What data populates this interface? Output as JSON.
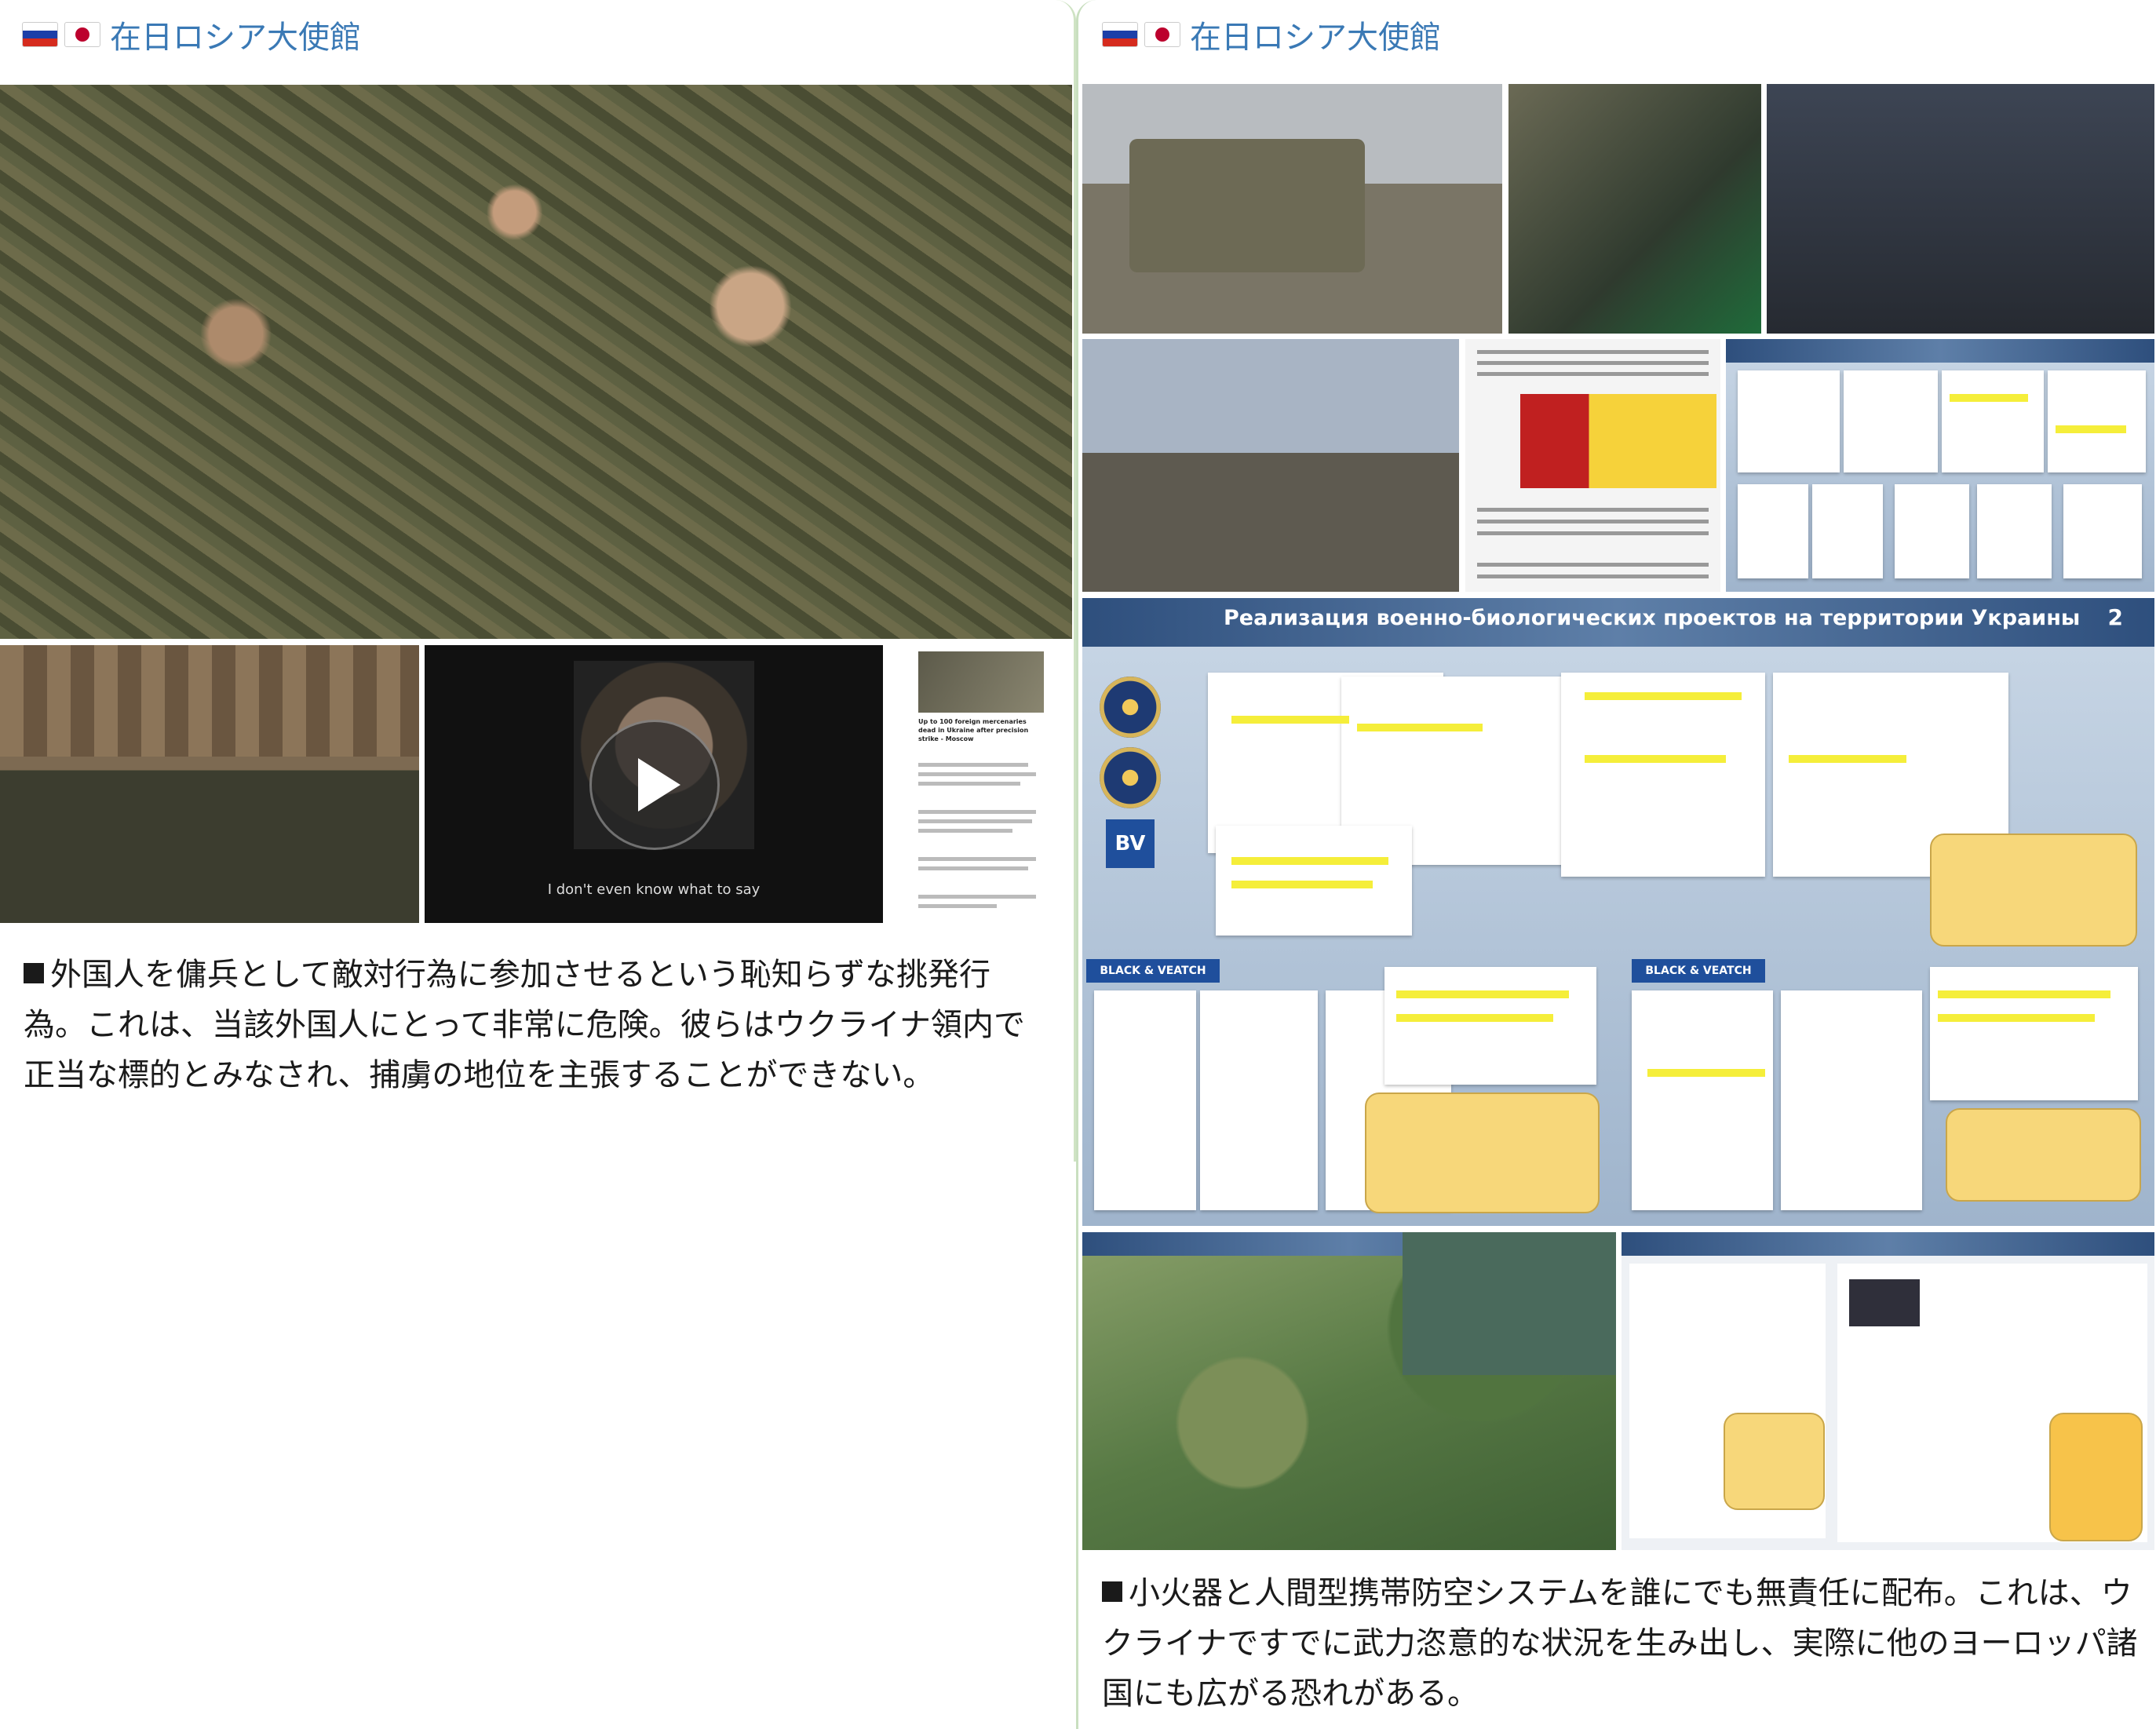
{
  "posts": [
    {
      "channel": {
        "name": "在日ロシア大使館",
        "flags": [
          "russia-flag-icon",
          "japan-flag-icon"
        ]
      },
      "media": {
        "video_caption": "I don't even know what to say",
        "article_headline": "Up to 100 foreign mercenaries dead in Ukraine after precision strike - Moscow"
      },
      "text": "外国人を傭兵として敵対行為に参加させるという恥知らずな挑発行為。これは、当該外国人にとって非常に危険。彼らはウクライナ領内で正当な標的とみなされ、捕虜の地位を主張することができない。"
    },
    {
      "channel": {
        "name": "在日ロシア大使館",
        "flags": [
          "russia-flag-icon",
          "japan-flag-icon"
        ]
      },
      "media": {
        "slide_title": "Реализация военно-биологических проектов на территории Украины",
        "slide_number": "2",
        "logo_left": "BLACK & VEATCH",
        "logo_right": "BLACK & VEATCH"
      },
      "text": "小火器と人間型携帯防空システムを誰にでも無責任に配布。これは、ウクライナですでに武力恣意的な状況を生み出し、実際に他のヨーロッパ諸国にも広がる恐れがある。"
    }
  ],
  "colors": {
    "channel_link": "#3a79b5",
    "divider": "#cfe3c4",
    "highlight": "#f5ee3a",
    "slide_blue": "#2e4f7d"
  }
}
